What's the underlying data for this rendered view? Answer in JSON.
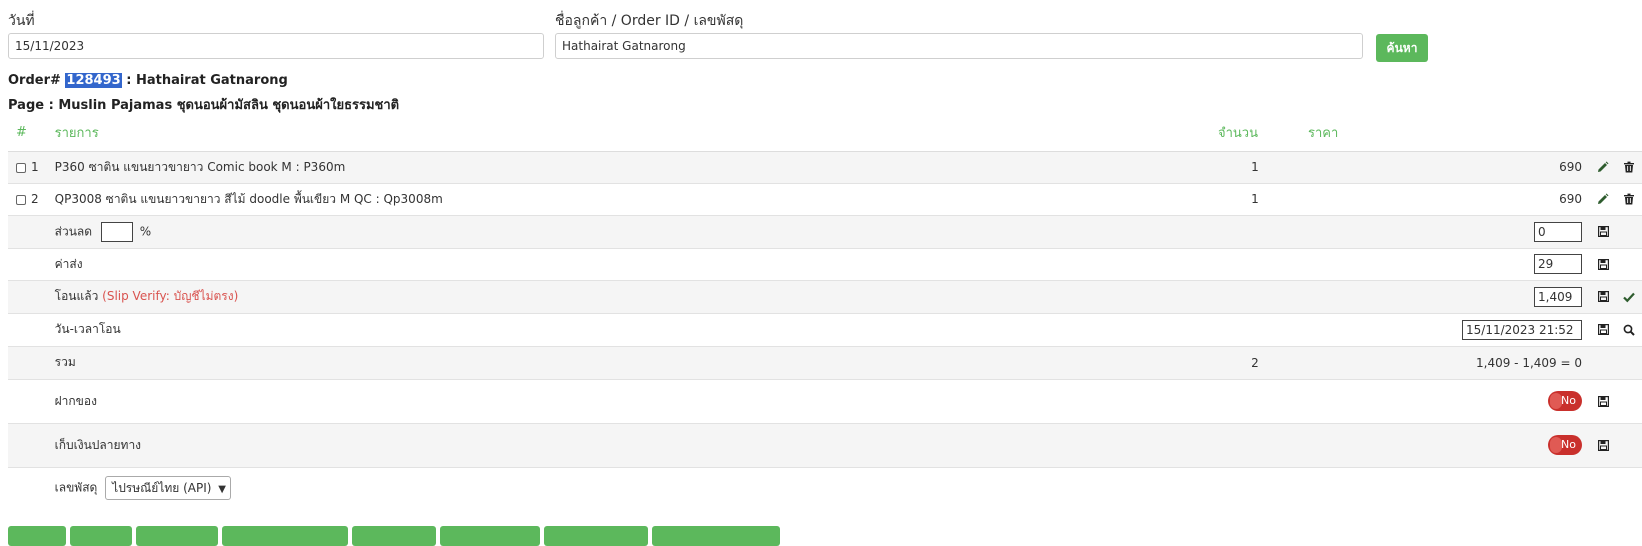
{
  "search": {
    "date_label": "วันที่",
    "date_value": "15/11/2023",
    "customer_label": "ชื่อลูกค้า / Order ID / เลขพัสดุ",
    "customer_value": "Hathairat Gatnarong",
    "search_button": "ค้นหา"
  },
  "order": {
    "prefix": "Order#",
    "id": "128493",
    "customer_suffix": ": Hathairat Gatnarong",
    "page_line": "Page : Muslin Pajamas ชุดนอนผ้ามัสลิน ชุดนอนผ้าใยธรรมชาติ"
  },
  "table": {
    "headers": {
      "num": "#",
      "item": "รายการ",
      "qty": "จำนวน",
      "price": "ราคา"
    },
    "items": [
      {
        "no": "1",
        "name": "P360 ซาติน แขนยาวขายาว Comic book M : P360m",
        "qty": "1",
        "price": "690"
      },
      {
        "no": "2",
        "name": "QP3008 ซาติน แขนยาวขายาว สีไม้ doodle พื้นเขียว M QC : Qp3008m",
        "qty": "1",
        "price": "690"
      }
    ],
    "discount": {
      "label": "ส่วนลด",
      "value": "",
      "unit": "%",
      "amount": "0"
    },
    "shipping": {
      "label": "ค่าส่ง",
      "amount": "29"
    },
    "transferred": {
      "label": "โอนแล้ว",
      "note": "(Slip Verify: บัญชีไม่ตรง)",
      "amount": "1,409"
    },
    "transfer_time": {
      "label": "วัน-เวลาโอน",
      "value": "15/11/2023 21:52"
    },
    "total": {
      "label": "รวม",
      "qty": "2",
      "calc": "1,409 - 1,409 = 0"
    },
    "deposit": {
      "label": "ฝากของ",
      "toggle": "No"
    },
    "cod": {
      "label": "เก็บเงินปลายทาง",
      "toggle": "No"
    },
    "tracking": {
      "label": "เลขพัสดุ",
      "carrier": "ไปรษณีย์ไทย (API)"
    }
  },
  "colors": {
    "accent": "#5cb85c",
    "danger": "#c9302c",
    "highlight": "#3366cc"
  },
  "icons": {
    "edit": "pencil-icon",
    "delete": "trash-icon",
    "save": "floppy-disk-icon",
    "ok": "check-icon",
    "search": "search-icon"
  }
}
